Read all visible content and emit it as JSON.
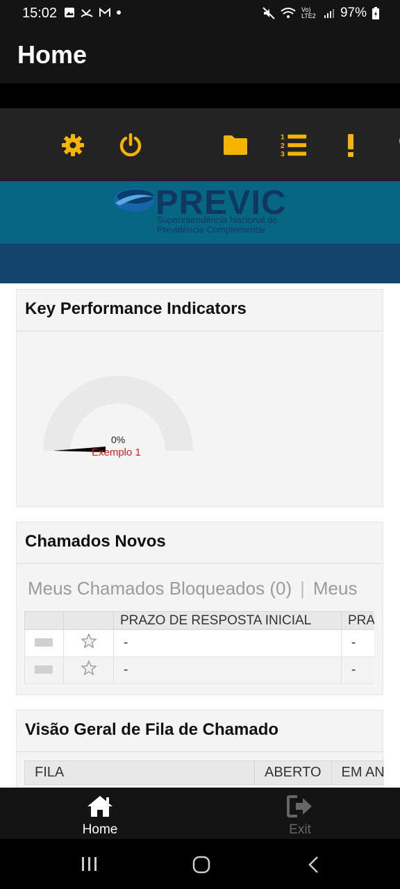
{
  "status_bar": {
    "time": "15:02",
    "network": "Vo) LTE2",
    "battery": "97%"
  },
  "app_bar": {
    "title": "Home"
  },
  "toolbar": {
    "icons": [
      "gear-icon",
      "power-icon",
      "folder-icon",
      "numbered-list-icon",
      "exclamation-icon",
      "lightbulb-icon"
    ],
    "accent": "#f5b400"
  },
  "banner": {
    "logo_word": "PREVIC",
    "logo_sub_1": "Superintendência Nacional de",
    "logo_sub_2": "Previdência Complementar"
  },
  "kpi": {
    "title": "Key Performance Indicators",
    "gauge_value": "0%",
    "gauge_percent": 0,
    "gauge_label": "Exemplo 1"
  },
  "chamados": {
    "title": "Chamados Novos",
    "tabs": [
      "Meus Chamados Bloqueados (0)",
      "Meus"
    ],
    "columns": [
      "",
      "",
      "PRAZO DE RESPOSTA INICIAL",
      "PRA"
    ],
    "rows": [
      {
        "col3": "-",
        "col4": "-"
      },
      {
        "col3": "-",
        "col4": "-"
      }
    ]
  },
  "visao": {
    "title": "Visão Geral de Fila de Chamado",
    "columns": [
      "FILA",
      "ABERTO",
      "EM AN"
    ]
  },
  "bottom_nav": {
    "home": "Home",
    "exit": "Exit"
  }
}
